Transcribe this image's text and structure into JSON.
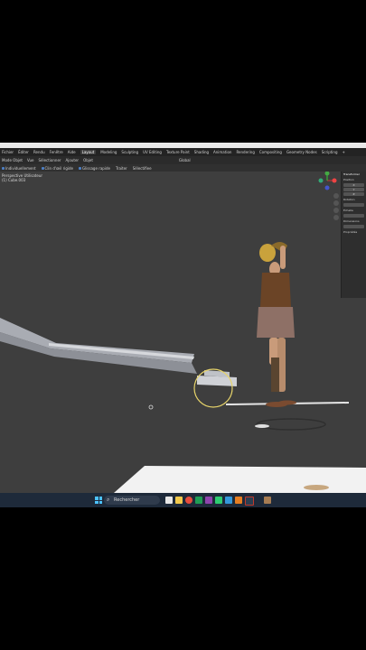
{
  "menubar": {
    "items": [
      "Fichier",
      "Éditer",
      "Rendu",
      "Fenêtre",
      "Aide"
    ],
    "workspaces": [
      "Layout",
      "Modeling",
      "Sculpting",
      "UV Editing",
      "Texture Paint",
      "Shading",
      "Animation",
      "Rendering",
      "Compositing",
      "Geometry Nodes",
      "Scripting"
    ],
    "active_workspace": "Layout",
    "add_tab": "+"
  },
  "header1": {
    "mode": "Mode Objet",
    "menus": [
      "Vue",
      "Sélectionner",
      "Ajouter",
      "Objet"
    ],
    "orientation": "Global"
  },
  "header2": {
    "items": [
      "Individuellement",
      "Clin d'œil rigide",
      "Glissage rapide",
      "Traiter",
      "Sélectifiee"
    ]
  },
  "viewport": {
    "view_name": "Perspective Utilisateur",
    "collection_line": "(1) Cube.003"
  },
  "npanel": {
    "title": "Transformer",
    "rows": [
      "Position",
      "X",
      "Y",
      "Z",
      "Rotation",
      "Échelle",
      "Dimensions",
      "Propriétés"
    ]
  },
  "taskbar": {
    "search_placeholder": "Rechercher"
  },
  "colors": {
    "viewport_bg": "#3e3e3e",
    "header_bg": "#2b2b2b",
    "accent_select": "#4d7fc4",
    "brush_circle": "#e6d36a",
    "taskbar_bg": "#1e2a3a"
  }
}
